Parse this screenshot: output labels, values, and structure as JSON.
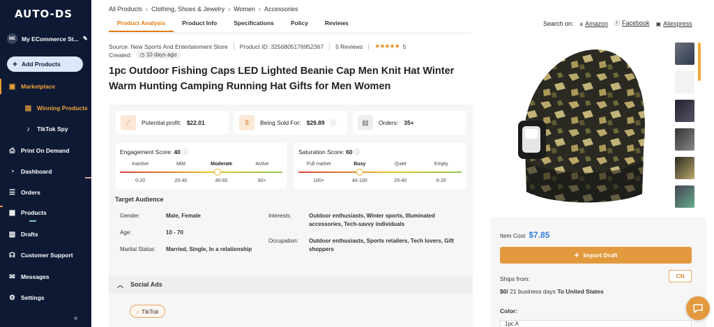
{
  "sidebar": {
    "logo": "AUTO-DS",
    "store_avatar": "ME",
    "store_name": "My ECommerce St...",
    "add_products": "Add Products",
    "items": [
      {
        "label": "Marketplace",
        "icon": "bag-icon"
      },
      {
        "label": "Winning Products",
        "icon": "trophy-icon"
      },
      {
        "label": "TikTok Spy",
        "icon": "tiktok-icon"
      },
      {
        "label": "Print On Demand",
        "icon": "print-icon"
      },
      {
        "label": "Dashboard",
        "icon": "gauge-icon"
      },
      {
        "label": "Orders",
        "icon": "orders-icon"
      },
      {
        "label": "Products",
        "icon": "box-icon"
      },
      {
        "label": "Drafts",
        "icon": "drafts-icon"
      },
      {
        "label": "Customer Support",
        "icon": "support-icon"
      },
      {
        "label": "Messages",
        "icon": "mail-icon"
      },
      {
        "label": "Settings",
        "icon": "gear-icon"
      }
    ],
    "collapse": "«"
  },
  "breadcrumb": [
    "All Products",
    "Clothing, Shoes & Jewelry",
    "Women",
    "Accessories"
  ],
  "tabs": [
    "Product Analysis",
    "Product Info",
    "Specifications",
    "Policy",
    "Reviews"
  ],
  "search_on": {
    "label": "Search on:",
    "links": [
      "Amazon",
      "Facebook",
      "Aliexpress"
    ]
  },
  "meta": {
    "source": "Source: New Sports And Entertainment Store",
    "product_id": "Product ID: 3256805176952367",
    "reviews": "5 Reviews",
    "stars": "★★★★★",
    "rating": "5",
    "created_label": "Created:",
    "created_value": "10 days ago"
  },
  "title": "1pc Outdoor Fishing Caps LED Lighted Beanie Cap Men Knit Hat Winter Warm Hunting Camping Running Hat Gifts for Men Women",
  "stats": {
    "profit_label": "Potential profit:",
    "profit_value": "$22.01",
    "sold_label": "Being Sold For:",
    "sold_value": "$29.89",
    "orders_label": "Orders:",
    "orders_value": "35+"
  },
  "engagement": {
    "label": "Engagement Score:",
    "value": "40",
    "levels": [
      "Inactive",
      "Mild",
      "Moderate",
      "Active"
    ],
    "ranges": [
      "0-20",
      "20-40",
      "40-60",
      "60+"
    ],
    "active_index": 2,
    "level": 0.6
  },
  "saturation": {
    "label": "Saturation Score:",
    "value": "60",
    "levels": [
      "Full market",
      "Busy",
      "Quiet",
      "Empty"
    ],
    "ranges": [
      "100+",
      "40-100",
      "20-40",
      "0-20"
    ],
    "active_index": 1,
    "level": 0.375
  },
  "target": {
    "title": "Target Audience",
    "gender_label": "Gender:",
    "gender": "Male, Female",
    "age_label": "Age:",
    "age": "10 - 70",
    "marital_label": "Marital Status:",
    "marital": "Married, Single, In a relationship",
    "interests_label": "Interests:",
    "interests": "Outdoor enthusiasts, Winter sports, Illuminated accessories, Tech-savvy individuals",
    "occupation_label": "Occupation:",
    "occupation": "Outdoor enthusiasts, Sports retailers, Tech lovers, Gift shoppers"
  },
  "social": {
    "title": "Social Ads",
    "chip": "TikTok"
  },
  "pricing": {
    "item_cost_label": "Item Cost",
    "item_cost": "$7.85",
    "import_label": "Import Draft",
    "ships_from_label": "Ships from:",
    "ships_from": "CN",
    "shipping_cost": "$0/",
    "shipping_days": " 21 business days ",
    "shipping_dest": "To United States",
    "color_label": "Color:",
    "color_value": "1pc A"
  },
  "colors": {
    "accent": "#e07b15",
    "sidebar_bg": "#0e1a34",
    "price_blue": "#2e7fd6",
    "button": "#e39a3e"
  }
}
